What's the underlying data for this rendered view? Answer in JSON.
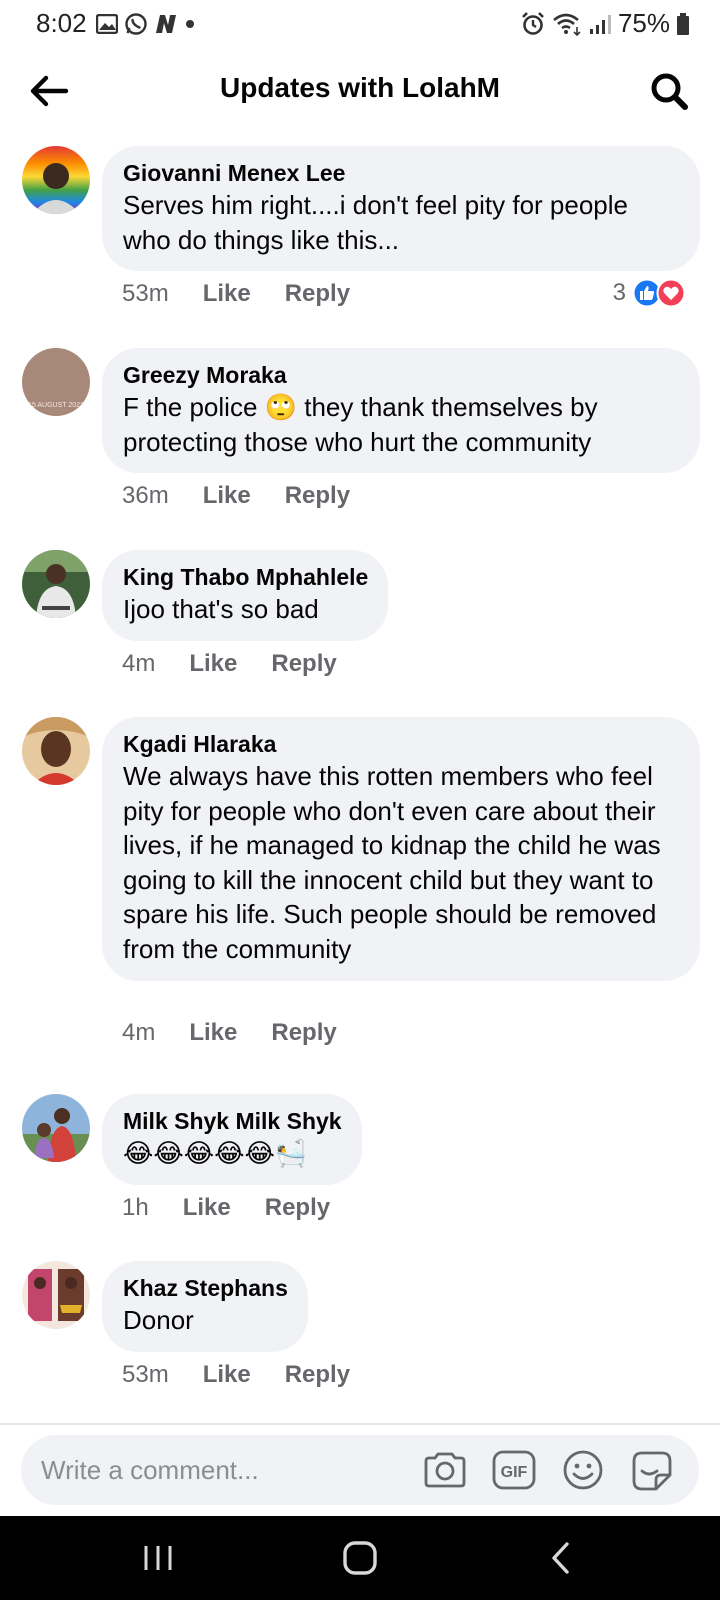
{
  "status_bar": {
    "time": "8:02",
    "battery": "75%"
  },
  "header": {
    "title": "Updates with LolahM",
    "back_icon": "arrow-left-icon",
    "search_icon": "search-icon"
  },
  "comments": [
    {
      "author": "Giovanni Menex Lee",
      "text": "Serves him right....i don't feel pity for people who do things like this...",
      "time": "53m",
      "like_label": "Like",
      "reply_label": "Reply",
      "reaction_count": "3",
      "reactions": [
        "like-reaction-icon",
        "love-reaction-icon"
      ]
    },
    {
      "author": "Greezy Moraka",
      "text": "F the police 🙄 they thank themselves by protecting those who hurt the community",
      "time": "36m",
      "like_label": "Like",
      "reply_label": "Reply",
      "avatar_caption": "15 AUGUST 2021"
    },
    {
      "author": "King Thabo Mphahlele",
      "text": "Ijoo that's so bad",
      "time": "4m",
      "like_label": "Like",
      "reply_label": "Reply"
    },
    {
      "author": "Kgadi Hlaraka",
      "text": "We always have this rotten members who feel pity for people who don't even care about their lives, if he managed to kidnap the child he was going to kill the innocent child but they want to spare his life. Such people should be removed from the community",
      "time": "4m",
      "like_label": "Like",
      "reply_label": "Reply"
    },
    {
      "author": "Milk Shyk Milk Shyk",
      "text": "😂😂😂😂😂🛀",
      "time": "1h",
      "like_label": "Like",
      "reply_label": "Reply"
    },
    {
      "author": "Khaz Stephans",
      "text": "Donor",
      "time": "53m",
      "like_label": "Like",
      "reply_label": "Reply"
    }
  ],
  "composer": {
    "placeholder": "Write a comment...",
    "icons": [
      "camera-icon",
      "gif-icon",
      "emoji-icon",
      "sticker-icon"
    ]
  },
  "colors": {
    "bubble": "#f0f2f5",
    "meta_text": "#65676b",
    "like_blue": "#1877f2",
    "love_red": "#f33e58"
  }
}
